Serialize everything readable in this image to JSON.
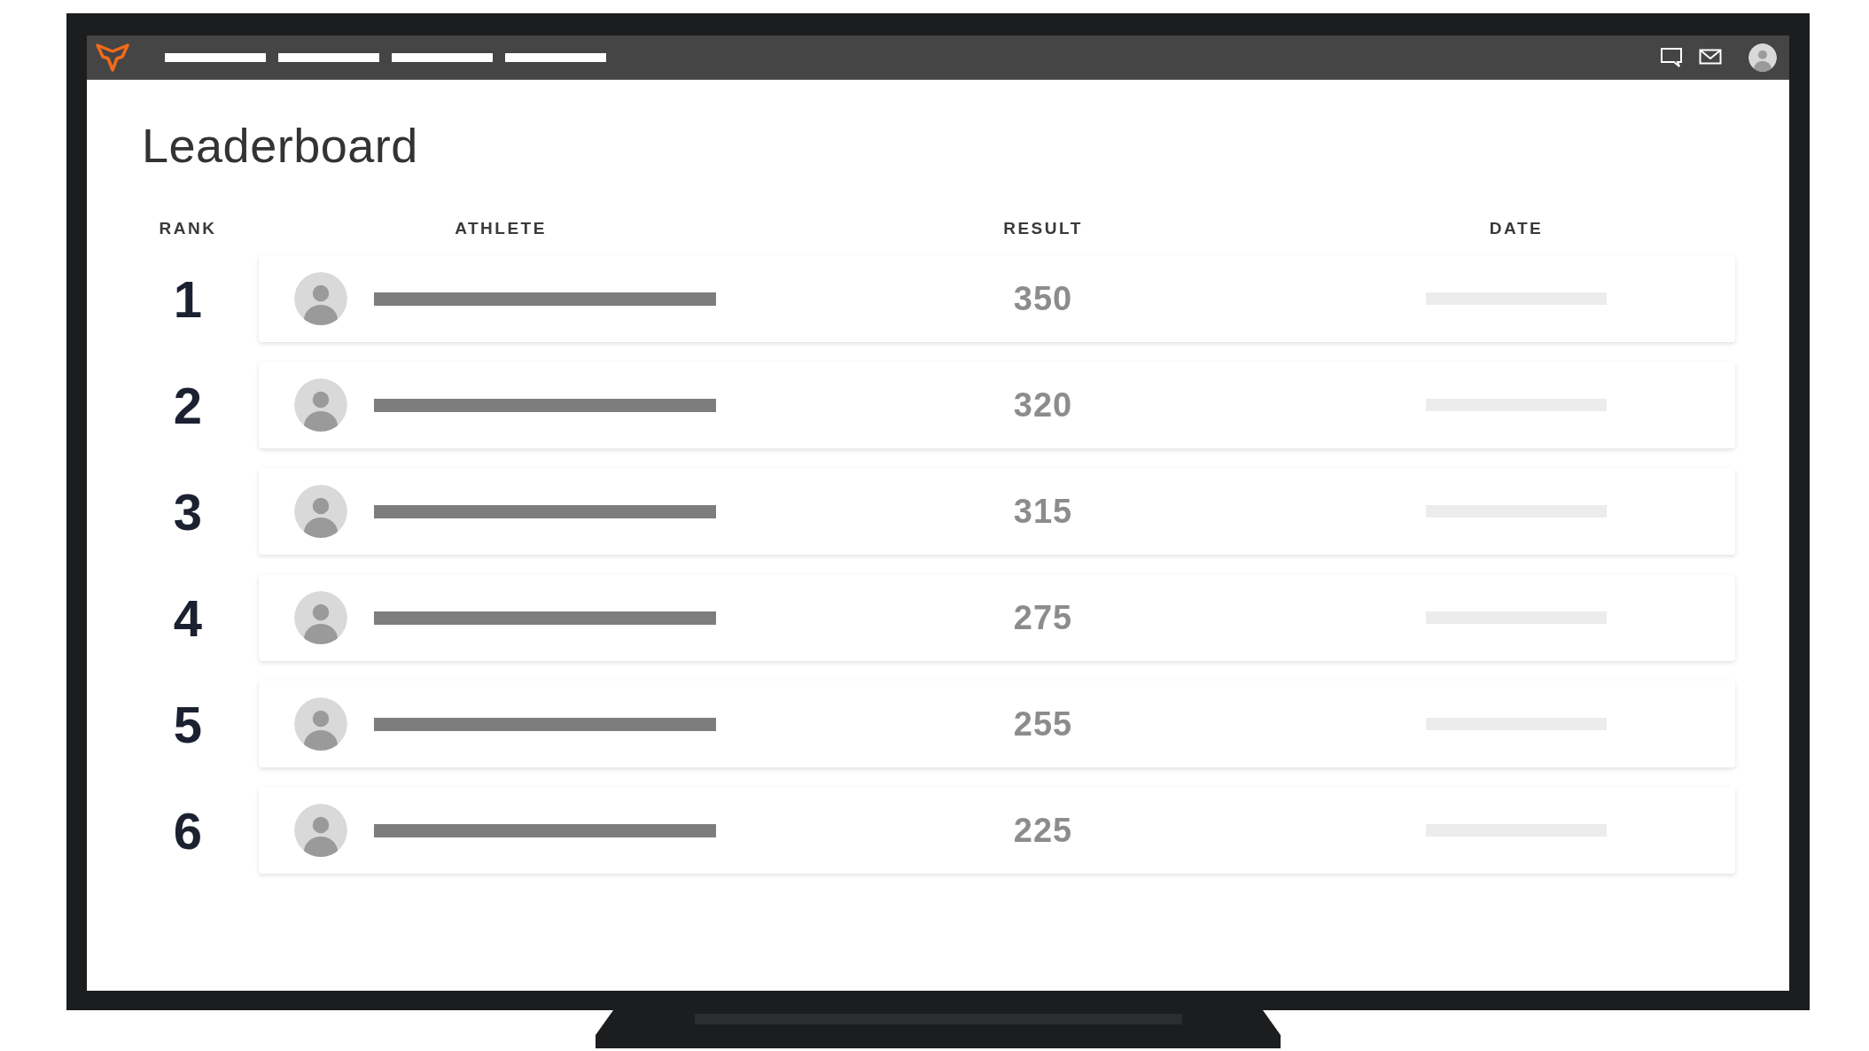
{
  "page": {
    "title": "Leaderboard"
  },
  "table": {
    "columns": [
      "RANK",
      "ATHLETE",
      "RESULT",
      "DATE"
    ],
    "rows": [
      {
        "rank": "1",
        "result": "350"
      },
      {
        "rank": "2",
        "result": "320"
      },
      {
        "rank": "3",
        "result": "315"
      },
      {
        "rank": "4",
        "result": "275"
      },
      {
        "rank": "5",
        "result": "255"
      },
      {
        "rank": "6",
        "result": "225"
      }
    ]
  }
}
